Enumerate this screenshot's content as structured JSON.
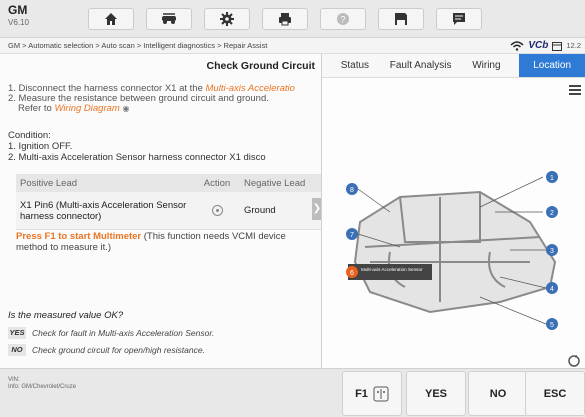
{
  "app": {
    "name": "GM",
    "version": "V6.10"
  },
  "toolbar": {
    "icons": [
      "home-icon",
      "vehicle-swap-icon",
      "settings-icon",
      "print-icon",
      "help-icon",
      "save-icon",
      "message-icon"
    ]
  },
  "breadcrumb": "GM > Automatic selection > Auto scan > Intelligent diagnostics > Repair Assist",
  "vci": {
    "brand": "VCb",
    "version": "12.2"
  },
  "left": {
    "title": "Check Ground Circuit",
    "step1_prefix": "1. Disconnect the harness connector X1 at the ",
    "step1_link": "Multi-axis Acceleratio",
    "step2": "2. Measure the resistance between ground circuit and ground.",
    "step2b_prefix": "Refer to ",
    "step2b_link": "Wiring Diagram",
    "condition_title": "Condition:",
    "condition_1": "1. Ignition OFF.",
    "condition_2": "2. Multi-axis Acceleration Sensor harness connector X1 disco",
    "table": {
      "headers": [
        "Positive Lead",
        "Action",
        "Negative Lead"
      ],
      "row": {
        "positive": "X1 Pin6 (Multi-axis Acceleration Sensor harness connector)",
        "negative": "Ground"
      }
    },
    "press_f1": "Press F1 to start Multimeter",
    "press_rest": " (This function needs VCMI device",
    "press_line2": "method to measure it.)",
    "question": "Is the measured value OK?",
    "yes_tag": "YES",
    "yes_text": "Check for fault in Multi-axis Acceleration Sensor.",
    "no_tag": "NO",
    "no_text": "Check ground circuit for open/high resistance."
  },
  "right": {
    "tabs": [
      {
        "label": "Status",
        "active": false
      },
      {
        "label": "Fault Analysis",
        "active": false
      },
      {
        "label": "Wiring",
        "active": false
      },
      {
        "label": "Location",
        "active": true
      }
    ],
    "diagram": {
      "markers": [
        "1",
        "2",
        "3",
        "4",
        "5",
        "6",
        "7",
        "8"
      ],
      "highlight_marker": "6",
      "highlight_label": "Multi-axis Acceleration Sensor"
    }
  },
  "bottom": {
    "vin_label": "VIN:",
    "info": "Info: GM/Chevrolet/Cruze",
    "f1": "F1",
    "yes": "YES",
    "no": "NO",
    "esc": "ESC"
  },
  "colors": {
    "accent_blue": "#2f7ad4",
    "link_orange": "#e87624",
    "marker_blue": "#3b6fb6"
  }
}
